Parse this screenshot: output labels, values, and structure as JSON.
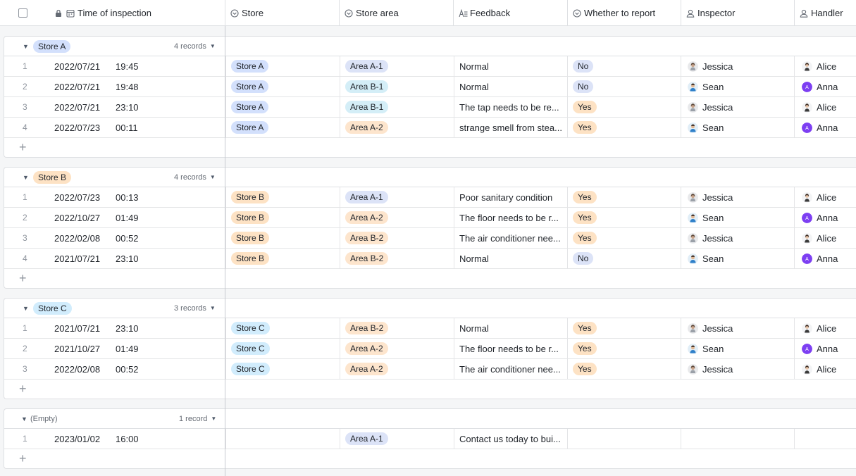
{
  "header": {
    "columns": [
      {
        "label": "Time of inspection",
        "icon": "date-field-icon"
      },
      {
        "label": "Store",
        "icon": "single-select-icon"
      },
      {
        "label": "Store area",
        "icon": "single-select-icon"
      },
      {
        "label": "Feedback",
        "icon": "text-field-icon"
      },
      {
        "label": "Whether to report",
        "icon": "single-select-icon"
      },
      {
        "label": "Inspector",
        "icon": "person-field-icon"
      },
      {
        "label": "Handler",
        "icon": "person-field-icon"
      }
    ]
  },
  "groups": [
    {
      "name": "Store A",
      "count": "4 records",
      "rows": [
        {
          "idx": "1",
          "date": "2022/07/21",
          "time": "19:45",
          "store": "Store A",
          "area": "Area A-1",
          "feedback": "Normal",
          "report": "No",
          "inspector": "Jessica",
          "handler": "Alice"
        },
        {
          "idx": "2",
          "date": "2022/07/21",
          "time": "19:48",
          "store": "Store A",
          "area": "Area B-1",
          "feedback": "Normal",
          "report": "No",
          "inspector": "Sean",
          "handler": "Anna"
        },
        {
          "idx": "3",
          "date": "2022/07/21",
          "time": "23:10",
          "store": "Store A",
          "area": "Area B-1",
          "feedback": "The tap needs to be re...",
          "report": "Yes",
          "inspector": "Jessica",
          "handler": "Alice"
        },
        {
          "idx": "4",
          "date": "2022/07/23",
          "time": "00:11",
          "store": "Store A",
          "area": "Area A-2",
          "feedback": "strange smell from stea...",
          "report": "Yes",
          "inspector": "Sean",
          "handler": "Anna"
        }
      ]
    },
    {
      "name": "Store B",
      "count": "4 records",
      "rows": [
        {
          "idx": "1",
          "date": "2022/07/23",
          "time": "00:13",
          "store": "Store B",
          "area": "Area A-1",
          "feedback": "Poor sanitary condition",
          "report": "Yes",
          "inspector": "Jessica",
          "handler": "Alice"
        },
        {
          "idx": "2",
          "date": "2022/10/27",
          "time": "01:49",
          "store": "Store B",
          "area": "Area A-2",
          "feedback": "The floor needs to be r...",
          "report": "Yes",
          "inspector": "Sean",
          "handler": "Anna"
        },
        {
          "idx": "3",
          "date": "2022/02/08",
          "time": "00:52",
          "store": "Store B",
          "area": "Area B-2",
          "feedback": "The air conditioner nee...",
          "report": "Yes",
          "inspector": "Jessica",
          "handler": "Alice"
        },
        {
          "idx": "4",
          "date": "2021/07/21",
          "time": "23:10",
          "store": "Store B",
          "area": "Area B-2",
          "feedback": "Normal",
          "report": "No",
          "inspector": "Sean",
          "handler": "Anna"
        }
      ]
    },
    {
      "name": "Store C",
      "count": "3 records",
      "rows": [
        {
          "idx": "1",
          "date": "2021/07/21",
          "time": "23:10",
          "store": "Store C",
          "area": "Area B-2",
          "feedback": "Normal",
          "report": "Yes",
          "inspector": "Jessica",
          "handler": "Alice"
        },
        {
          "idx": "2",
          "date": "2021/10/27",
          "time": "01:49",
          "store": "Store C",
          "area": "Area A-2",
          "feedback": "The floor needs to be r...",
          "report": "Yes",
          "inspector": "Sean",
          "handler": "Anna"
        },
        {
          "idx": "3",
          "date": "2022/02/08",
          "time": "00:52",
          "store": "Store C",
          "area": "Area A-2",
          "feedback": "The air conditioner nee...",
          "report": "Yes",
          "inspector": "Jessica",
          "handler": "Alice"
        }
      ]
    },
    {
      "name": "(Empty)",
      "count": "1 record",
      "rows": [
        {
          "idx": "1",
          "date": "2023/01/02",
          "time": "16:00",
          "store": "",
          "area": "Area A-1",
          "feedback": "Contact us today to bui...",
          "report": "",
          "inspector": "",
          "handler": ""
        }
      ]
    }
  ],
  "colors": {
    "store_a": "#d3e0fc",
    "store_b": "#fde2c4",
    "store_c": "#d1ecfc",
    "yes": "#fde2c4",
    "no": "#dce3f7",
    "anna_avatar": "#7d3ff2"
  }
}
